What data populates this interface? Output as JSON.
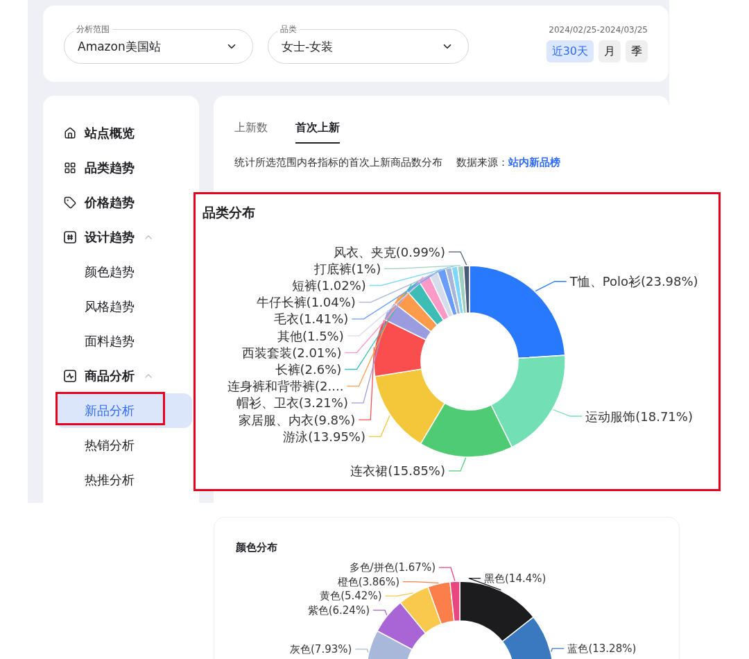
{
  "filters": [
    {
      "label": "分析范围",
      "value": "Amazon美国站"
    },
    {
      "label": "品类",
      "value": "女士-女装"
    }
  ],
  "date_range": "2024/02/25-2024/03/25",
  "periods": [
    {
      "label": "近30天",
      "selected": true
    },
    {
      "label": "月",
      "selected": false
    },
    {
      "label": "季",
      "selected": false
    }
  ],
  "sidebar": {
    "items": [
      {
        "label": "站点概览",
        "selected": false
      },
      {
        "label": "品类趋势",
        "selected": false
      },
      {
        "label": "价格趋势",
        "selected": false
      },
      {
        "label": "设计趋势",
        "selected": false,
        "expanded": true,
        "children": [
          {
            "label": "颜色趋势",
            "selected": false,
            "highlighted": false
          },
          {
            "label": "风格趋势",
            "selected": false,
            "highlighted": false
          },
          {
            "label": "面料趋势",
            "selected": false,
            "highlighted": false
          }
        ]
      },
      {
        "label": "商品分析",
        "selected": false,
        "expanded": true,
        "children": [
          {
            "label": "新品分析",
            "selected": true,
            "highlighted": true
          },
          {
            "label": "热销分析",
            "selected": false,
            "highlighted": false
          },
          {
            "label": "热推分析",
            "selected": false,
            "highlighted": false
          }
        ]
      }
    ]
  },
  "tabs": [
    {
      "label": "上新数",
      "selected": false
    },
    {
      "label": "首次上新",
      "selected": true
    }
  ],
  "description": {
    "text": "统计所选范围内各指标的首次上新商品数分布",
    "source_label": "数据来源：",
    "source_link": "站内新品榜"
  },
  "category_panel": {
    "title": "品类分布",
    "highlighted": true,
    "chart_data": {
      "type": "donut",
      "categories": [
        "T恤、Polo衫(23.98%)",
        "运动服饰(18.71%)",
        "连衣裙(15.85%)",
        "游泳(13.95%)",
        "家居服、内衣(9.8%)",
        "帽衫、卫衣(3.21%)",
        "连身裤和背带裤(2....",
        "长裤(2.6%)",
        "西装套装(2.01%)",
        "其他(1.5%)",
        "毛衣(1.41%)",
        "牛仔长裤(1.04%)",
        "短裤(1.02%)",
        "打底裤(1%)",
        "风衣、夹克(0.99%)"
      ],
      "values": [
        23.98,
        18.71,
        15.85,
        13.95,
        9.8,
        3.21,
        2.93,
        2.6,
        2.01,
        1.5,
        1.41,
        1.04,
        1.02,
        1,
        0.99
      ],
      "colors": [
        "#2979ff",
        "#72dfb4",
        "#4ecb73",
        "#f4c63a",
        "#fa4e4e",
        "#9b9ce0",
        "#fd9b4b",
        "#3ebdb6",
        "#fb9ac8",
        "#d5dcec",
        "#6a9cfb",
        "#a6b5d8",
        "#7fd6fb",
        "#a0cfbd",
        "#4a5a78"
      ]
    }
  },
  "color_panel": {
    "title": "颜色分布",
    "chart_data": {
      "type": "donut",
      "categories": [
        "黑色(14.4%)",
        "蓝色(13.28%)",
        null,
        "灰色(7.93%)",
        "紫色(6.24%)",
        "黄色(5.42%)",
        "橙色(3.86%)",
        "多色/拼色(1.67%)"
      ],
      "values": [
        14.4,
        13.28,
        null,
        7.93,
        6.24,
        5.42,
        3.86,
        1.67
      ],
      "colors": [
        "#1c1c1f",
        "#3a78c0",
        null,
        "#a8b8da",
        "#a964d6",
        "#f8c94d",
        "#fa7f4a",
        "#e8467c"
      ]
    }
  }
}
